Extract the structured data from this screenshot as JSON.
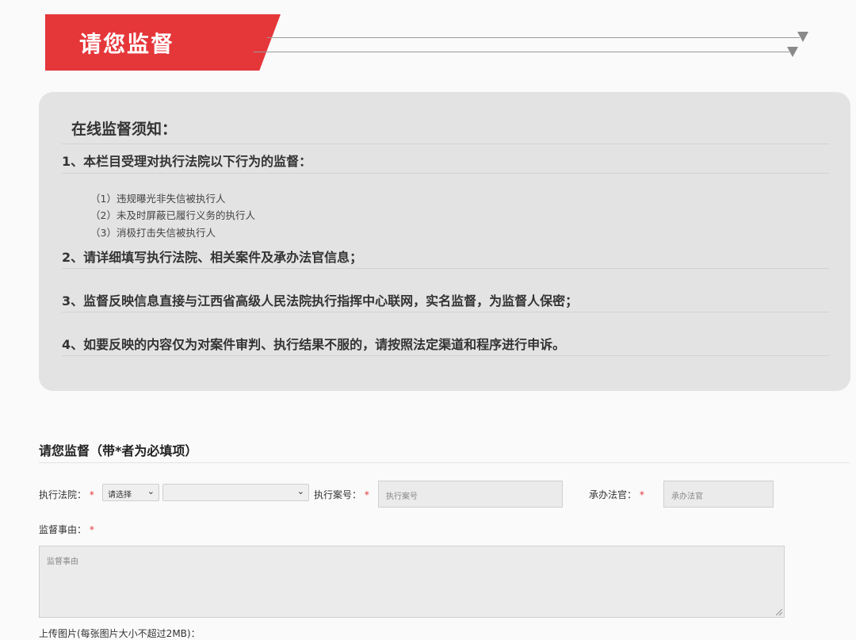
{
  "header": {
    "title": "请您监督"
  },
  "notice": {
    "title": "在线监督须知：",
    "rules": [
      "1、本栏目受理对执行法院以下行为的监督：",
      "2、请详细填写执行法院、相关案件及承办法官信息；",
      "3、监督反映信息直接与江西省高级人民法院执行指挥中心联网，实名监督，为监督人保密；",
      "4、如要反映的内容仅为对案件审判、执行结果不服的，请按照法定渠道和程序进行申诉。"
    ],
    "sub_items": [
      "（1）违规曝光非失信被执行人",
      "（2）未及时屏蔽已履行义务的执行人",
      "（3）消极打击失信被执行人"
    ]
  },
  "form": {
    "title": "请您监督（带*者为必填项）",
    "required_mark": "*",
    "court_label": "执行法院：",
    "court_select_value": "请选择",
    "court_select2_value": "",
    "case_label": "执行案号：",
    "case_placeholder": "执行案号",
    "judge_label": "承办法官：",
    "judge_placeholder": "承办法官",
    "reason_label": "监督事由：",
    "reason_placeholder": "监督事由",
    "upload_label": "上传图片(每张图片大小不超过2MB)："
  }
}
